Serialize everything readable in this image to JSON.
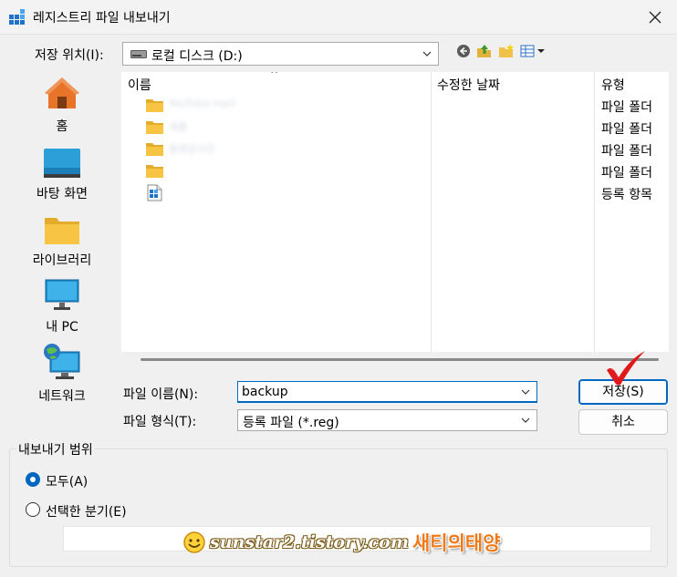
{
  "window": {
    "title": "레지스트리 파일 내보내기"
  },
  "location": {
    "label": "저장 위치(I):",
    "value": "로컬 디스크 (D:)"
  },
  "places": [
    {
      "label": "홈"
    },
    {
      "label": "바탕 화면"
    },
    {
      "label": "라이브러리"
    },
    {
      "label": "내 PC"
    },
    {
      "label": "네트워크"
    }
  ],
  "columns": {
    "name": "이름",
    "modified": "수정한 날짜",
    "type": "유형"
  },
  "files": [
    {
      "name": "YouTube mp3",
      "type": "파일 폴더",
      "icon": "folder-icon"
    },
    {
      "name": "새폴",
      "type": "파일 폴더",
      "icon": "folder-icon"
    },
    {
      "name": "동영상사진",
      "type": "파일 폴더",
      "icon": "folder-icon"
    },
    {
      "name": "",
      "type": "파일 폴더",
      "icon": "folder-icon"
    },
    {
      "name": "",
      "type": "등록 항목",
      "icon": "registry-file-icon"
    }
  ],
  "filename": {
    "label": "파일 이름(N):",
    "value": "backup"
  },
  "filetype": {
    "label": "파일 형식(T):",
    "value": "등록 파일 (*.reg)"
  },
  "buttons": {
    "save": "저장(S)",
    "cancel": "취소"
  },
  "export_range": {
    "title": "내보내기 범위",
    "all": "모두(A)",
    "selected": "선택한 분기(E)",
    "selected_value": "",
    "current": "all"
  },
  "watermark": {
    "site": "sunstar2.tistory.com",
    "brand": "새티의태양"
  },
  "colors": {
    "accent": "#0067c0",
    "folder": "#f8c444",
    "check": "#e0181a"
  }
}
